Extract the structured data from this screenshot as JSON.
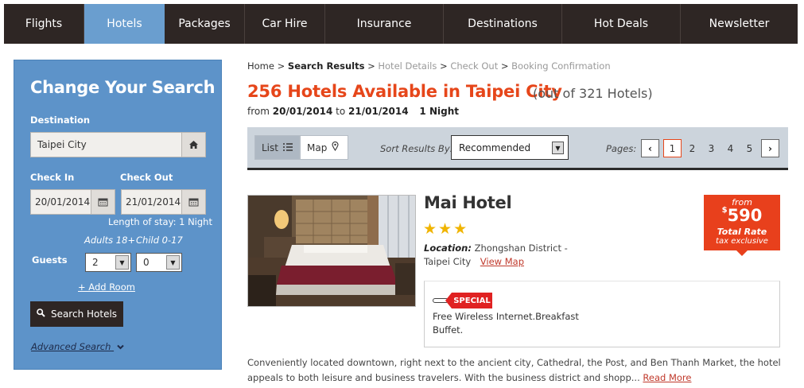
{
  "nav": {
    "items": [
      {
        "label": "Flights"
      },
      {
        "label": "Hotels"
      },
      {
        "label": "Packages"
      },
      {
        "label": "Car Hire"
      },
      {
        "label": "Insurance"
      },
      {
        "label": "Destinations"
      },
      {
        "label": "Hot Deals"
      },
      {
        "label": "Newsletter"
      }
    ],
    "active": "Hotels"
  },
  "search_panel": {
    "title": "Change Your Search",
    "destination_label": "Destination",
    "destination_value": "Taipei City",
    "checkin_label": "Check In",
    "checkout_label": "Check Out",
    "checkin_value": "20/01/2014",
    "checkout_value": "21/01/2014",
    "length_of_stay": "Length of stay: 1 Night",
    "adults_label": "Adults 18+",
    "child_label": "Child 0-17",
    "guests_label": "Guests",
    "adults_value": "2",
    "child_value": "0",
    "add_room": "+ Add Room",
    "search_button": "Search Hotels",
    "advanced_search": "Advanced Search"
  },
  "breadcrumb": {
    "home": "Home",
    "sep": ">",
    "current": "Search Results",
    "step3": "Hotel Details",
    "step4": "Check Out",
    "step5": "Booking Confirmation"
  },
  "results": {
    "title": "256 Hotels Available in Taipei City",
    "subtitle": "(out of 321 Hotels)",
    "from_label": "from",
    "from_date": "20/01/2014",
    "to_label": "to",
    "to_date": "21/01/2014",
    "nights": "1 Night"
  },
  "toolbar": {
    "list_label": "List",
    "map_label": "Map",
    "sort_label": "Sort Results By:",
    "sort_value": "Recommended",
    "pages_label": "Pages:",
    "pages": [
      "1",
      "2",
      "3",
      "4",
      "5"
    ],
    "current_page": "1",
    "prev_arrow": "‹",
    "next_arrow": "›"
  },
  "hotel": {
    "name": "Mai Hotel",
    "stars": "★★★",
    "location_label": "Location:",
    "location_value": "Zhongshan District - Taipei City",
    "view_map": "View Map",
    "price_from": "from",
    "price_currency": "$",
    "price_value": "590",
    "price_label": "Total Rate",
    "price_tax": "tax exclusive",
    "special_tag": "SPECIAL",
    "special_text": "Free Wireless Internet.Breakfast Buffet.",
    "description": "Conveniently located downtown, right next to the ancient city, Cathedral, the Post, and Ben Thanh Market, the hotel appeals to both leisure and business travelers. With the business district and shopp...",
    "read_more": "Read More"
  },
  "colors": {
    "nav_bg": "#2e2624",
    "nav_active": "#6a9ecf",
    "panel_bg": "#5d93c9",
    "accent": "#e6461a",
    "star": "#f0b400"
  }
}
